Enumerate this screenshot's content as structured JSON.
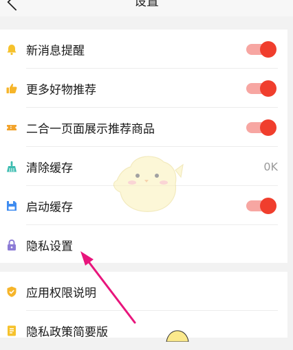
{
  "header": {
    "title": "设置"
  },
  "settings": [
    {
      "label": "新消息提醒",
      "icon": "bell-icon",
      "toggle": true
    },
    {
      "label": "更多好物推荐",
      "icon": "thumbs-up-icon",
      "toggle": true
    },
    {
      "label": "二合一页面展示推荐商品",
      "icon": "ticket-icon",
      "toggle": true
    },
    {
      "label": "清除缓存",
      "icon": "broom-icon",
      "value": "0K"
    },
    {
      "label": "启动缓存",
      "icon": "save-icon",
      "toggle": true
    },
    {
      "label": "隐私设置",
      "icon": "lock-icon"
    }
  ],
  "more": [
    {
      "label": "应用权限说明",
      "icon": "shield-icon"
    },
    {
      "label": "隐私政策简要版",
      "icon": "document-icon"
    }
  ],
  "colors": {
    "toggle_on_knob": "#f03e2d",
    "toggle_on_track": "#f7a6a2",
    "bell": "#f6c22c",
    "thumbs": "#f6b52a",
    "ticket": "#f2a32b",
    "broom": "#3cbcb0",
    "save": "#3f8cf0",
    "lock": "#8c7bd6",
    "shield": "#f6b52a",
    "document": "#f6c22c",
    "annotation_arrow": "#e8157c"
  }
}
